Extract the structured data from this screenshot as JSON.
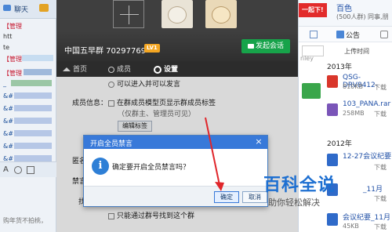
{
  "left_chat": {
    "tab_chat": "聊天",
    "lines": [
      "【管理",
      "htt",
      "te",
      "【管理",
      "【管理",
      "_",
      "&#",
      "&#",
      "&#",
      "&#",
      "&#",
      "&#"
    ],
    "input_hint": "购年货不拍桃，"
  },
  "group_window": {
    "group_name": "中国五早群 70297769",
    "level_badge": "LV1",
    "start_chat_button": "发起会话",
    "nav": {
      "home": "首页",
      "members": "成员",
      "settings": "设置"
    },
    "settings": {
      "partial_top": "可以进入并可以发言",
      "member_info_label": "成员信息：",
      "member_info_checkbox": "在群成员模型页显示群成员标签",
      "member_info_note": "（仅群主、管理员可见）",
      "edit_tags_button": "编辑标签",
      "anonymous_label": "匿名",
      "mute_label": "禁言",
      "find_label": "找",
      "find_checkbox": "只能通过群号找到这个群"
    }
  },
  "dialog": {
    "title": "开启全员禁言",
    "message": "确定要开启全员禁言吗？",
    "ok_button": "确定",
    "cancel_button": "取消"
  },
  "right_panel": {
    "top_badge": "一起下!",
    "top_title": "百色",
    "top_sub": "(500人群) 同事,朋",
    "announce": "公告",
    "uploaded_label": "上传时间",
    "side_nley": "nley",
    "year_2013": "2013年",
    "files": [
      {
        "name": "QSG-DRV8412-",
        "meta": "810KB",
        "action": "下载"
      },
      {
        "name": "103_PANA.rar",
        "meta": "258MB",
        "action": "下载"
      },
      {
        "name": "12-27会议纪要",
        "meta": "",
        "action": "下载"
      },
      {
        "name": "",
        "meta": "",
        "action": "下载"
      },
      {
        "name": "会议纪要_11月",
        "meta": "45KB",
        "action": "下载"
      }
    ],
    "year_2012": "2012年",
    "partial_name": "_11月",
    "colors": {
      "pdf": "#d9362b",
      "rar": "#7a55b8",
      "word": "#2f6ac9",
      "green": "#3aa64b"
    }
  },
  "watermark": {
    "title": "百科全说",
    "subtitle": "助你轻松解决"
  }
}
